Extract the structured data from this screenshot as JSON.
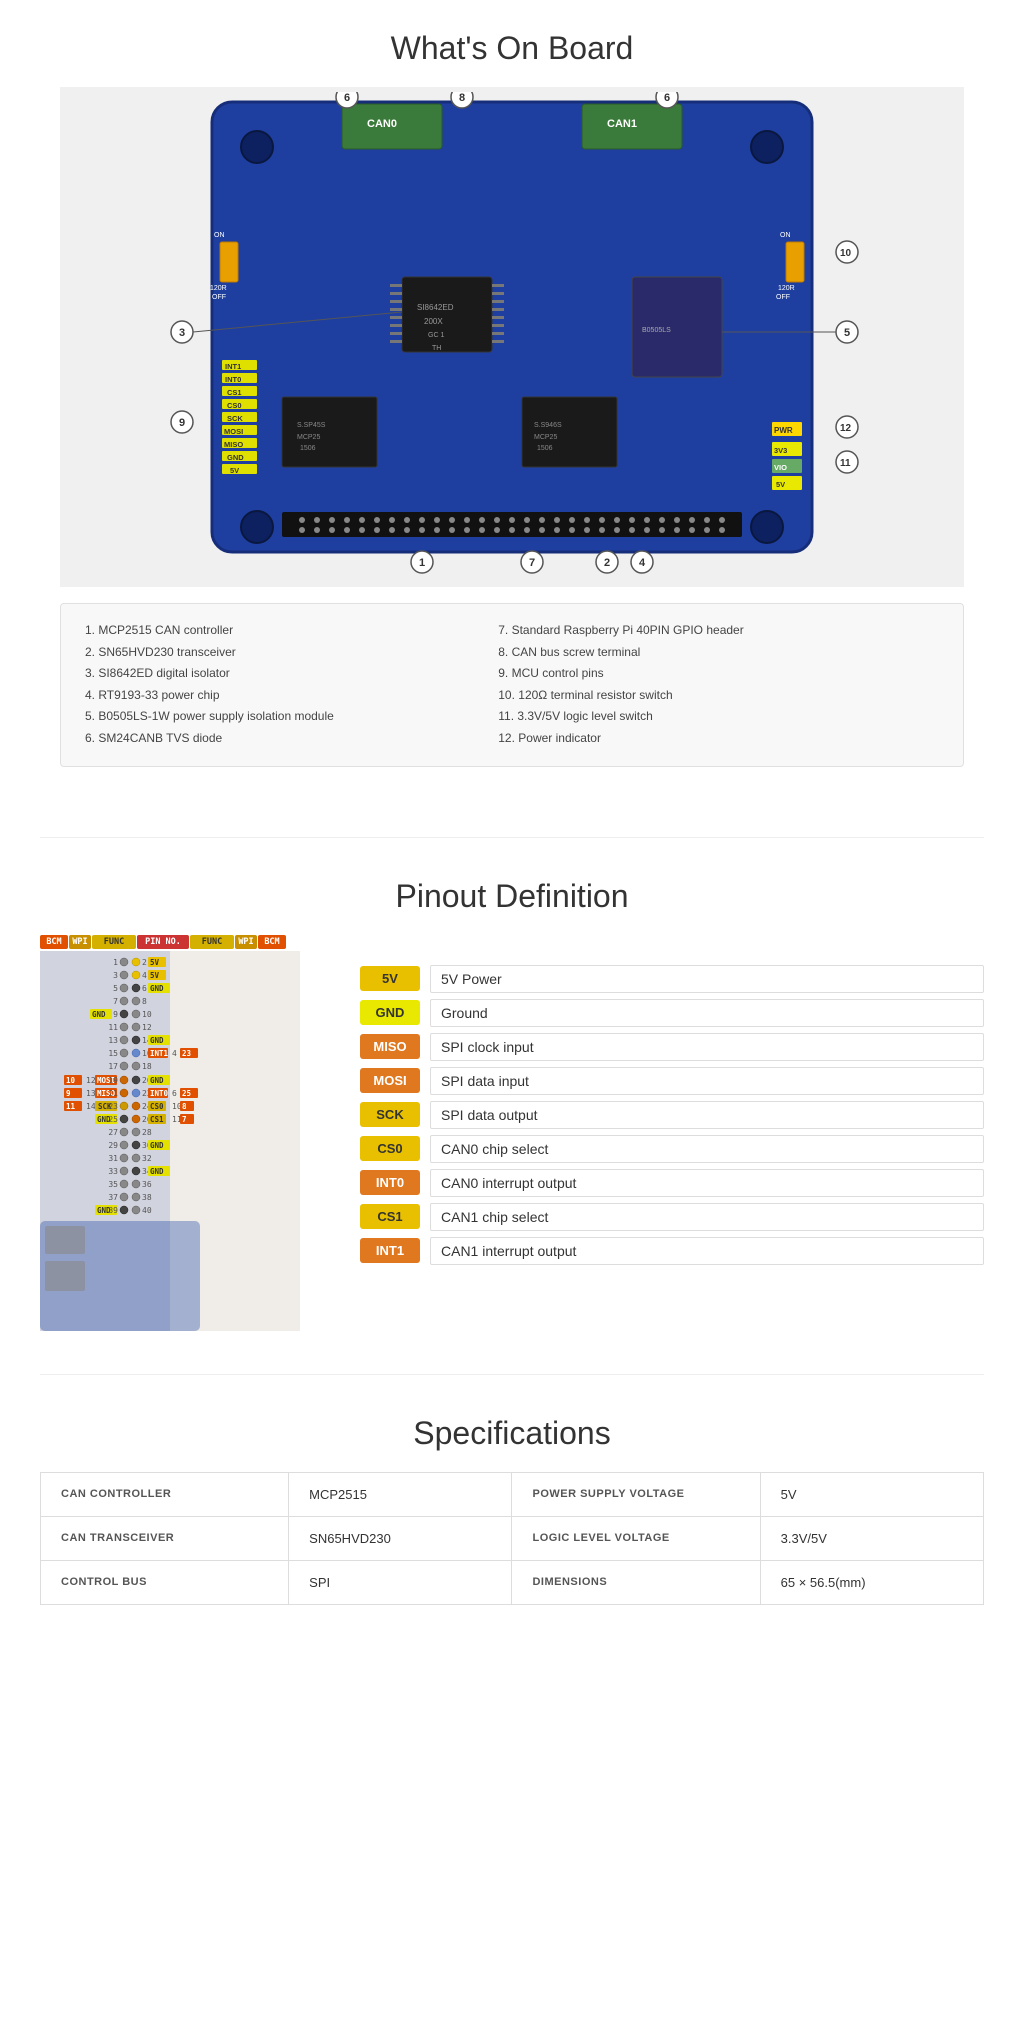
{
  "page": {
    "sections": {
      "whats_on_board": {
        "title": "What's On Board"
      },
      "pinout": {
        "title": "Pinout Definition"
      },
      "specs": {
        "title": "Specifications"
      }
    }
  },
  "board_legend": {
    "left_items": [
      "1. MCP2515 CAN controller",
      "2. SN65HVD230 transceiver",
      "3. SI8642ED digital isolator",
      "4. RT9193-33 power chip",
      "5. B0505LS-1W power supply isolation module",
      "6. SM24CANB TVS diode"
    ],
    "right_items": [
      "7. Standard Raspberry Pi 40PIN GPIO header",
      "8. CAN bus screw terminal",
      "9. MCU control pins",
      "10. 120Ω terminal resistor switch",
      "11. 3.3V/5V logic level switch",
      "12. Power indicator"
    ]
  },
  "pinout_legend": [
    {
      "badge": "5V",
      "badge_class": "badge-5v",
      "desc": "5V Power"
    },
    {
      "badge": "GND",
      "badge_class": "badge-gnd",
      "desc": "Ground"
    },
    {
      "badge": "MISO",
      "badge_class": "badge-miso",
      "desc": "SPI clock input"
    },
    {
      "badge": "MOSI",
      "badge_class": "badge-mosi",
      "desc": "SPI data input"
    },
    {
      "badge": "SCK",
      "badge_class": "badge-sck",
      "desc": "SPI data output"
    },
    {
      "badge": "CS0",
      "badge_class": "badge-cs0",
      "desc": "CAN0 chip select"
    },
    {
      "badge": "INT0",
      "badge_class": "badge-int0",
      "desc": "CAN0 interrupt output"
    },
    {
      "badge": "CS1",
      "badge_class": "badge-cs1",
      "desc": "CAN1 chip select"
    },
    {
      "badge": "INT1",
      "badge_class": "badge-int1",
      "desc": "CAN1 interrupt output"
    }
  ],
  "specifications": [
    {
      "label": "CAN CONTROLLER",
      "value": "MCP2515",
      "label2": "POWER SUPPLY VOLTAGE",
      "value2": "5V"
    },
    {
      "label": "CAN TRANSCEIVER",
      "value": "SN65HVD230",
      "label2": "LOGIC LEVEL VOLTAGE",
      "value2": "3.3V/5V"
    },
    {
      "label": "CONTROL BUS",
      "value": "SPI",
      "label2": "DIMENSIONS",
      "value2": "65 × 56.5(mm)"
    }
  ]
}
